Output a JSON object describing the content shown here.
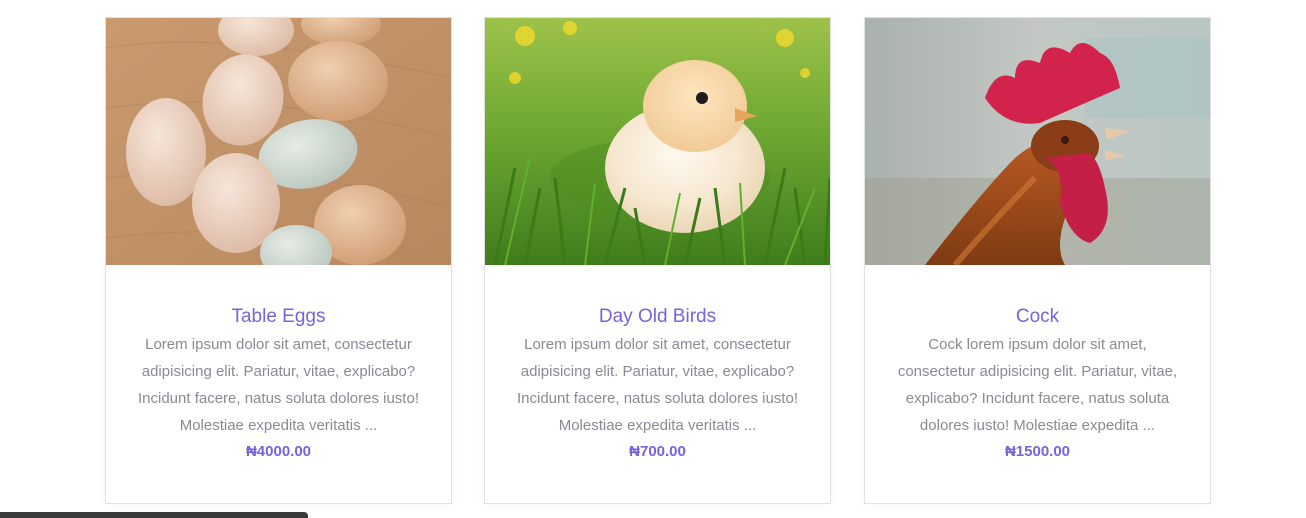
{
  "products": [
    {
      "title": "Table Eggs",
      "description": "Lorem ipsum dolor sit amet, consectetur adipisicing elit. Pariatur, vitae, explicabo? Incidunt facere, natus soluta dolores iusto! Molestiae expedita veritatis ...",
      "price": "₦4000.00",
      "image": "eggs-photo"
    },
    {
      "title": "Day Old Birds",
      "description": "Lorem ipsum dolor sit amet, consectetur adipisicing elit. Pariatur, vitae, explicabo? Incidunt facere, natus soluta dolores iusto! Molestiae expedita veritatis ...",
      "price": "₦700.00",
      "image": "chick-photo"
    },
    {
      "title": "Cock",
      "description": "Cock lorem ipsum dolor sit amet, consectetur adipisicing elit. Pariatur, vitae, explicabo? Incidunt facere, natus soluta dolores iusto! Molestiae expedita ...",
      "price": "₦1500.00",
      "image": "rooster-photo"
    }
  ],
  "colors": {
    "accent": "#7664d8",
    "text_muted": "#8a8a94",
    "border": "#e2e2e2"
  }
}
